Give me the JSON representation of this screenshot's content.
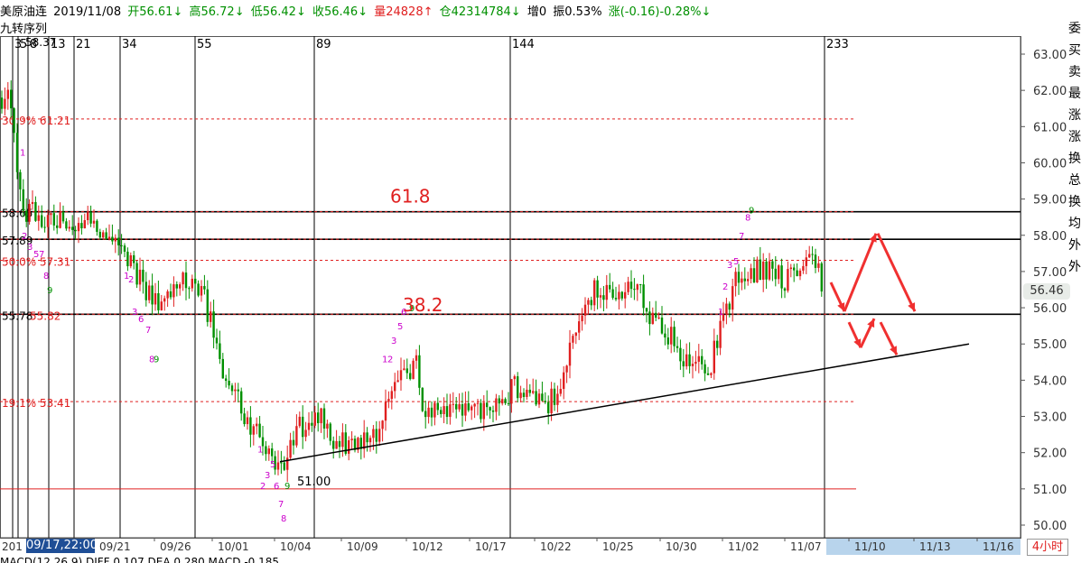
{
  "header": {
    "name": "美原油连",
    "date": "2019/11/08",
    "open": "开56.61↓",
    "high": "高56.72↓",
    "low": "低56.42↓",
    "close": "收56.46↓",
    "volume": "量24828↑",
    "position": "仓42314784↓",
    "increase": "增0",
    "amplitude": "振0.53%",
    "change": "涨(-0.16)-0.28%↓"
  },
  "subtitle": "九转序列",
  "right_strip": [
    "委",
    "买",
    "卖",
    "最",
    "涨",
    "涨",
    "换",
    "总",
    "换",
    "均",
    "外",
    "外"
  ],
  "price_tag": "56.46",
  "date_highlight": "09/17,22:00",
  "period_label": "4小时",
  "indicator_line": "MACD(12,26,9)  DIFF 0.107  DEA 0.280  MACD -0.185",
  "colors": {
    "up": "#e02020",
    "down": "#009000",
    "purple": "#cc00cc",
    "fib": "#e02020",
    "black": "#000000"
  },
  "chart_data": {
    "type": "candlestick",
    "y_axis": {
      "min": 50,
      "max": 63,
      "ticks": [
        "63.00",
        "62.00",
        "61.00",
        "60.00",
        "59.00",
        "58.00",
        "57.00",
        "56.00",
        "55.00",
        "54.00",
        "53.00",
        "52.00",
        "51.00",
        "50.00"
      ]
    },
    "x_axis": {
      "ticks": [
        "09/21",
        "09/26",
        "10/01",
        "10/04",
        "10/09",
        "10/12",
        "10/17",
        "10/22",
        "10/25",
        "10/30",
        "11/02",
        "11/07",
        "11/10",
        "11/13",
        "11/16"
      ],
      "partial_left": "201"
    },
    "fib_counts": [
      "3",
      "5",
      "8",
      "13",
      "21",
      "34",
      "55",
      "89",
      "144",
      "233"
    ],
    "fib_levels": [
      {
        "label": "30.9% 61.21",
        "value": 61.21
      },
      {
        "label": "58.65",
        "value": 58.65
      },
      {
        "label": "57.89",
        "value": 57.89
      },
      {
        "label": "50.0% 57.31",
        "value": 57.31
      },
      {
        "label": "55.78 55.82",
        "value": 55.82
      },
      {
        "label": "19.1% 53.41",
        "value": 53.41
      },
      {
        "label": "",
        "value": 51.0
      }
    ],
    "top_partial_label": "58.37",
    "annotations": [
      {
        "text": "61.8",
        "value": 59.1
      },
      {
        "text": "38.2",
        "value": 56.1
      },
      {
        "text": "51.00",
        "value": 51.2
      }
    ],
    "trendline": {
      "start": [
        "10/03",
        51.75
      ],
      "end": [
        "11/16",
        55.0
      ]
    },
    "last_close": 56.46
  }
}
